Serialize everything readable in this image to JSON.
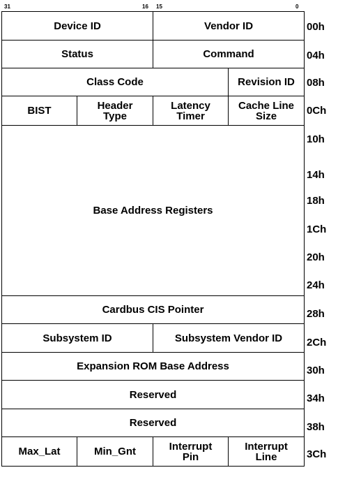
{
  "bit_labels": {
    "b31": "31",
    "b16": "16",
    "b15": "15",
    "b0": "0"
  },
  "fields": {
    "device_id": "Device ID",
    "vendor_id": "Vendor ID",
    "status": "Status",
    "command": "Command",
    "class_code": "Class Code",
    "revision_id": "Revision ID",
    "bist": "BIST",
    "header_type_1": "Header",
    "header_type_2": "Type",
    "latency_timer_1": "Latency",
    "latency_timer_2": "Timer",
    "cache_line_size_1": "Cache Line",
    "cache_line_size_2": "Size",
    "base_address_registers": "Base Address Registers",
    "cardbus_cis_pointer": "Cardbus CIS Pointer",
    "subsystem_id": "Subsystem ID",
    "subsystem_vendor_id": "Subsystem Vendor ID",
    "expansion_rom_base_address": "Expansion ROM Base Address",
    "reserved_34": "Reserved",
    "reserved_38": "Reserved",
    "max_lat": "Max_Lat",
    "min_gnt": "Min_Gnt",
    "interrupt_pin_1": "Interrupt",
    "interrupt_pin_2": "Pin",
    "interrupt_line_1": "Interrupt",
    "interrupt_line_2": "Line"
  },
  "offsets": [
    "00h",
    "04h",
    "08h",
    "0Ch",
    "10h",
    "14h",
    "18h",
    "1Ch",
    "20h",
    "24h",
    "28h",
    "2Ch",
    "30h",
    "34h",
    "38h",
    "3Ch"
  ]
}
